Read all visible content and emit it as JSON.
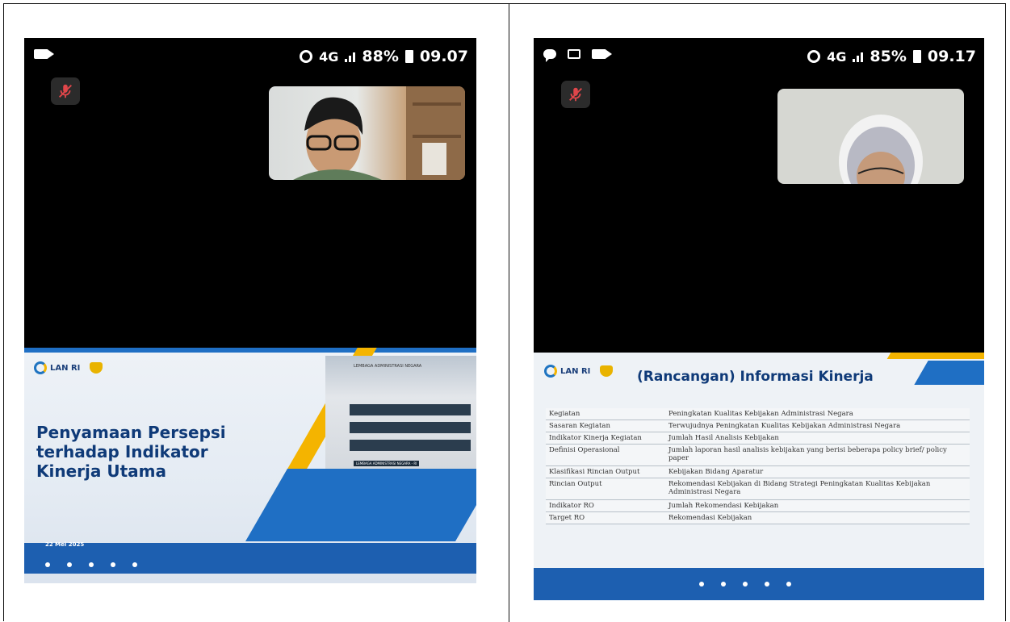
{
  "left_phone": {
    "status": {
      "network": "4G",
      "battery": "88%",
      "time": "09.07"
    },
    "slide": {
      "org": "LAN RI",
      "title_lines": [
        "Penyamaan Persepsi",
        "terhadap Indikator",
        "Kinerja Utama"
      ],
      "date": "22 Mei 2025",
      "building_sign": "LEMBAGA ADMINISTRASI NEGARA",
      "building_sign2": "LEMBAGA ADMINISTRASI NEGARA - RI"
    }
  },
  "right_phone": {
    "status": {
      "network": "4G",
      "battery": "85%",
      "time": "09.17"
    },
    "slide": {
      "org": "LAN RI",
      "title": "(Rancangan) Informasi Kinerja",
      "rows": [
        {
          "key": "Kegiatan",
          "value": "Peningkatan Kualitas Kebijakan Administrasi Negara"
        },
        {
          "key": "Sasaran Kegiatan",
          "value": "Terwujudnya Peningkatan Kualitas Kebijakan Administrasi Negara"
        },
        {
          "key": "Indikator Kinerja Kegiatan",
          "value": "Jumlah Hasil Analisis Kebijakan"
        },
        {
          "key": "Definisi Operasional",
          "value": "Jumlah laporan hasil analisis kebijakan yang berisi beberapa policy brief/ policy paper"
        },
        {
          "key": "Klasifikasi Rincian Output",
          "value": "Kebijakan Bidang Aparatur"
        },
        {
          "key": "Rincian Output",
          "value": "Rekomendasi Kebijakan di Bidang Strategi Peningkatan Kualitas Kebijakan Administrasi Negara"
        },
        {
          "key": "Indikator RO",
          "value": "Jumlah Rekomendasi Kebijakan"
        },
        {
          "key": "Target RO",
          "value": "Rekomendasi Kebijakan"
        }
      ]
    }
  },
  "icons": {
    "camera": "camera-icon",
    "chat": "chat-icon",
    "gallery": "gallery-icon",
    "sync": "sync-icon",
    "signal": "signal-icon",
    "battery": "battery-icon",
    "mic_off": "mic-off-icon"
  },
  "colors": {
    "mic_off": "#e0464a",
    "brand_blue": "#1f6fc4",
    "brand_yellow": "#f4b400",
    "title_navy": "#0f3a78"
  }
}
